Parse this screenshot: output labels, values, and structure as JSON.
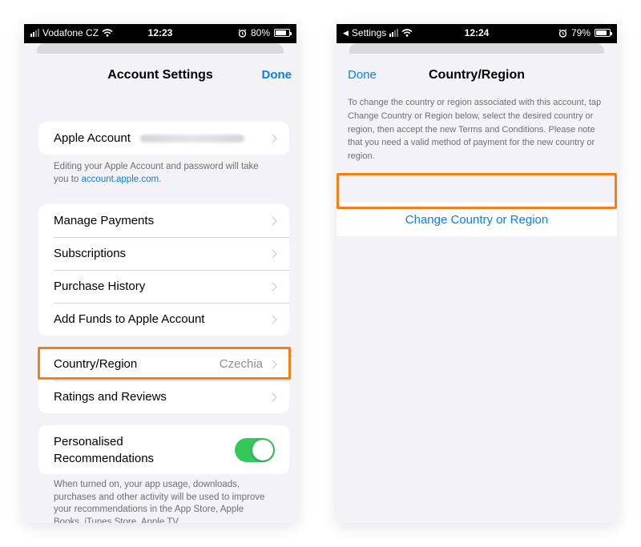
{
  "left_phone": {
    "status": {
      "carrier": "Vodafone CZ",
      "time": "12:23",
      "battery": "80%",
      "battery_level": 0.8
    },
    "nav": {
      "title": "Account Settings",
      "done": "Done"
    },
    "apple_account": {
      "label": "Apple Account"
    },
    "account_note": {
      "text": "Editing your Apple Account and password will take you to ",
      "link": "account.apple.com",
      "end": "."
    },
    "payments_group": [
      {
        "label": "Manage Payments"
      },
      {
        "label": "Subscriptions"
      },
      {
        "label": "Purchase History"
      },
      {
        "label": "Add Funds to Apple Account"
      }
    ],
    "country_row": {
      "label": "Country/Region",
      "value": "Czechia"
    },
    "ratings_row": {
      "label": "Ratings and Reviews"
    },
    "personalised": {
      "label": "Personalised Recommendations",
      "enabled": true
    },
    "personalised_note": "When turned on, your app usage, downloads, purchases and other activity will be used to improve your recommendations in the App Store, Apple Books, iTunes Store, Apple TV"
  },
  "right_phone": {
    "status": {
      "back_label": "Settings",
      "time": "12:24",
      "battery": "79%",
      "battery_level": 0.79
    },
    "nav": {
      "title": "Country/Region",
      "done": "Done"
    },
    "description": "To change the country or region associated with this account, tap Change Country or Region below, select the desired country or region, then accept the new Terms and Conditions. Please note that you need a valid method of payment for the new country or region.",
    "change_button": "Change Country or Region"
  },
  "colors": {
    "accent": "#0a7cf0",
    "highlight": "#f47f16",
    "toggle_on": "#34c759"
  }
}
